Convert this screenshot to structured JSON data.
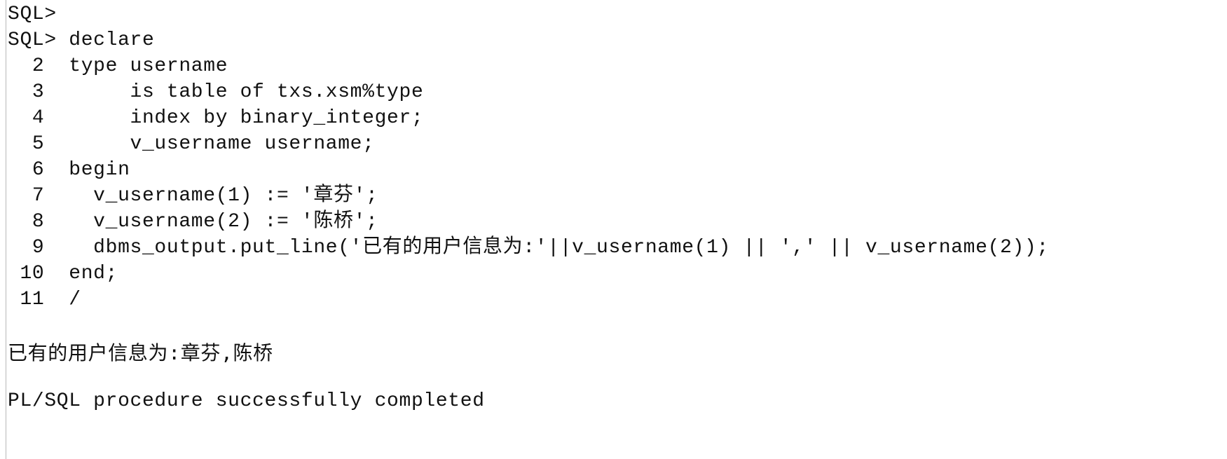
{
  "terminal": {
    "lines": [
      {
        "number": "",
        "prefix": "SQL>",
        "text": ""
      },
      {
        "number": "",
        "prefix": "SQL>",
        "text": "declare"
      },
      {
        "number": "2",
        "prefix": "",
        "text": "type username"
      },
      {
        "number": "3",
        "prefix": "",
        "text": "     is table of txs.xsm%type"
      },
      {
        "number": "4",
        "prefix": "",
        "text": "     index by binary_integer;"
      },
      {
        "number": "5",
        "prefix": "",
        "text": "     v_username username;"
      },
      {
        "number": "6",
        "prefix": "",
        "text": "begin"
      },
      {
        "number": "7",
        "prefix": "",
        "text": "  v_username(1) := '章芬';"
      },
      {
        "number": "8",
        "prefix": "",
        "text": "  v_username(2) := '陈桥';"
      },
      {
        "number": "9",
        "prefix": "",
        "text": "  dbms_output.put_line('已有的用户信息为:'||v_username(1) || ',' || v_username(2));"
      },
      {
        "number": "10",
        "prefix": "",
        "text": "end;"
      },
      {
        "number": "11",
        "prefix": "",
        "text": "/"
      }
    ],
    "output": "已有的用户信息为:章芬,陈桥",
    "status": "PL/SQL procedure successfully completed"
  }
}
